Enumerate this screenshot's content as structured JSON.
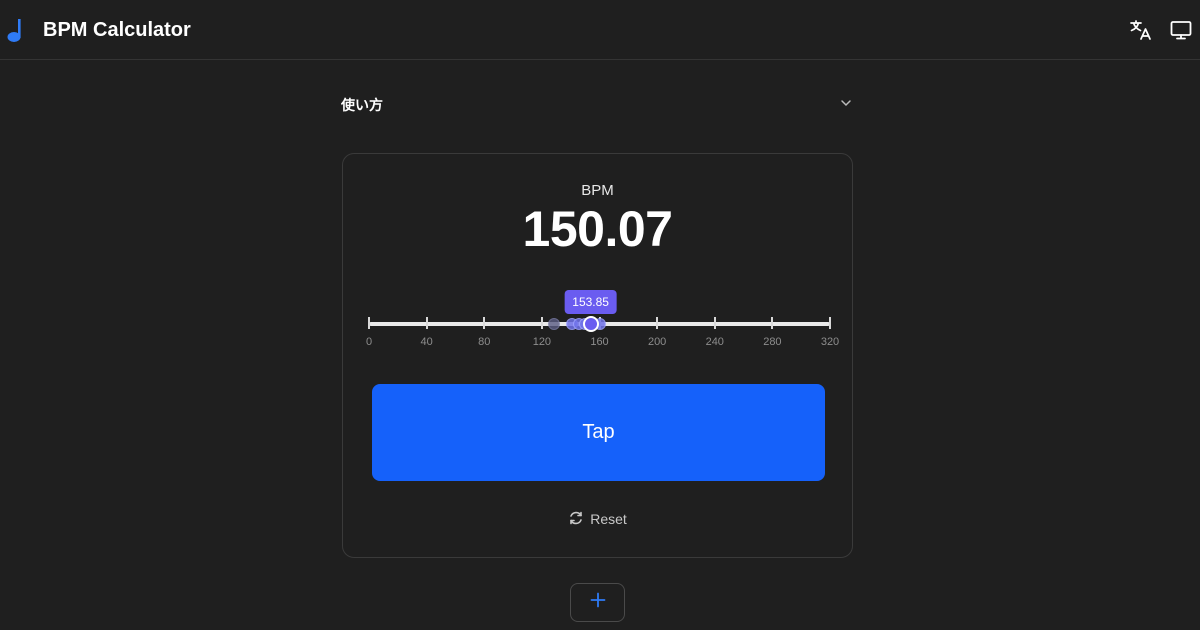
{
  "header": {
    "title": "BPM Calculator",
    "icons": {
      "logo": "music-note-icon",
      "translate": "translate-icon",
      "display": "display-icon"
    },
    "logo_color": "#2f7bf6"
  },
  "howto": {
    "label": "使い方",
    "icon": "chevron-down-icon"
  },
  "card": {
    "bpm_label": "BPM",
    "bpm_value": "150.07",
    "slider": {
      "min": 0,
      "max": 320,
      "current": 153.85,
      "current_label": "153.85",
      "ticks": [
        "0",
        "40",
        "80",
        "120",
        "160",
        "200",
        "240",
        "280",
        "320"
      ],
      "tap_values": [
        128.2,
        141,
        146,
        150,
        156,
        160
      ],
      "accent": "#6a5cf0"
    },
    "tap_label": "Tap",
    "tap_color": "#1561fa",
    "reset_label": "Reset",
    "reset_icon": "refresh-icon"
  },
  "add_button": {
    "icon": "plus-icon",
    "accent": "#2f7bf6"
  }
}
